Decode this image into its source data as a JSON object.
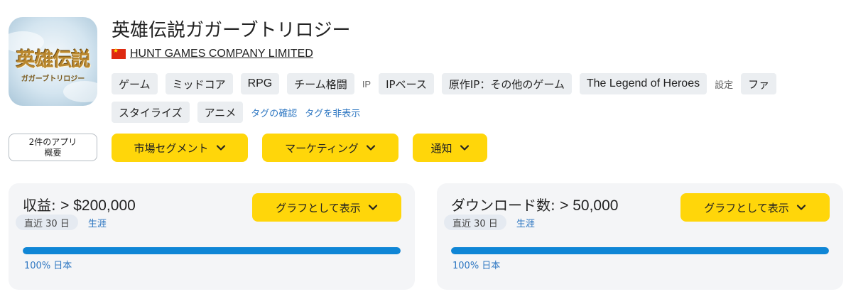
{
  "app": {
    "icon_logo_text": "英雄伝説",
    "icon_logo_subtext": "ガガーブトリロジー",
    "title": "英雄伝説ガガーブトリロジー",
    "publisher": "HUNT GAMES COMPANY LIMITED",
    "publisher_flag": "china-flag-icon"
  },
  "tags": {
    "row1": [
      "ゲーム",
      "ミッドコア",
      "RPG",
      "チーム格闘"
    ],
    "ip_label": "IP",
    "ip_tags": [
      "IPベース",
      "原作IP：その他のゲーム",
      "The Legend of Heroes"
    ],
    "setting_label": "設定",
    "setting_tag": "ファ",
    "row2": [
      "スタイライズ",
      "アニメ"
    ],
    "confirm_link": "タグの確認",
    "hide_link": "タグを非表示"
  },
  "related_apps": {
    "line1": "2件のアプリ",
    "line2": "概要"
  },
  "menus": {
    "market_segment": "市場セグメント",
    "marketing": "マーケティング",
    "notification": "通知"
  },
  "revenue": {
    "label": "収益:",
    "value": "> $200,000",
    "graph_button": "グラフとして表示",
    "period_selected": "直近 30 日",
    "period_alt": "生涯",
    "bar_percent": 100,
    "bar_caption": "100% 日本"
  },
  "downloads": {
    "label": "ダウンロード数:",
    "value": "> 50,000",
    "graph_button": "グラフとして表示",
    "period_selected": "直近 30 日",
    "period_alt": "生涯",
    "bar_percent": 100,
    "bar_caption": "100% 日本"
  },
  "colors": {
    "accent_yellow": "#ffd60a",
    "bar_blue": "#0f86d6",
    "link_blue": "#2e77c2"
  }
}
